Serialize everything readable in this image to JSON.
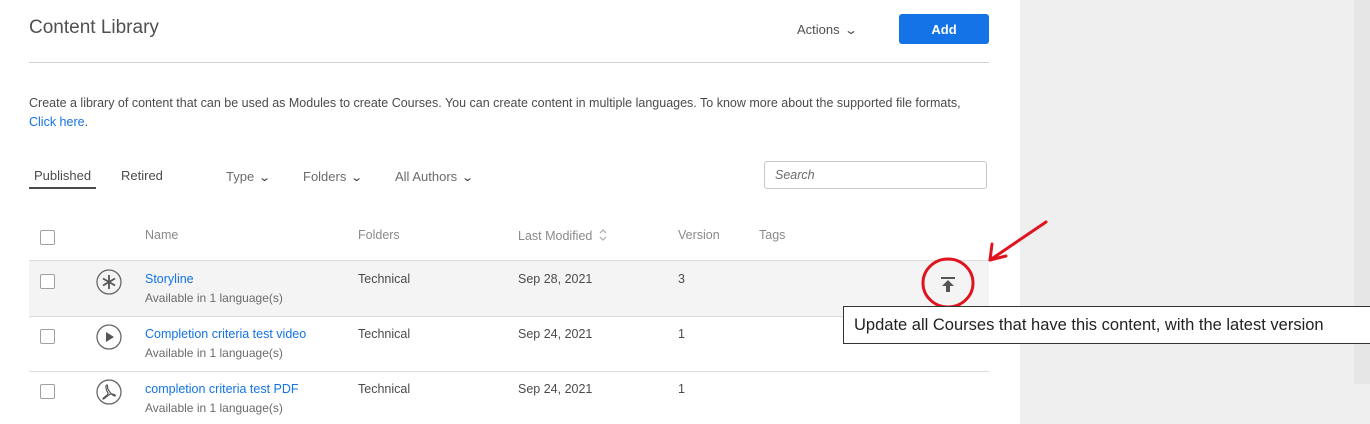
{
  "header": {
    "title": "Content Library",
    "actions_label": "Actions",
    "add_label": "Add"
  },
  "description": {
    "text": "Create a library of content that can be used as Modules to create Courses. You can create content in multiple languages. To know more about the supported file formats, ",
    "link": "Click here",
    "tail": "."
  },
  "tabs": {
    "published": "Published",
    "retired": "Retired"
  },
  "filters": {
    "type": "Type",
    "folders": "Folders",
    "authors": "All Authors"
  },
  "search": {
    "placeholder": "Search"
  },
  "columns": {
    "name": "Name",
    "folders": "Folders",
    "last_modified": "Last Modified",
    "version": "Version",
    "tags": "Tags"
  },
  "rows": [
    {
      "name": "Storyline",
      "sub": "Available in 1 language(s)",
      "folder": "Technical",
      "date": "Sep 28, 2021",
      "version": "3",
      "icon": "asterisk-icon"
    },
    {
      "name": "Completion criteria test video",
      "sub": "Available in 1 language(s)",
      "folder": "Technical",
      "date": "Sep 24, 2021",
      "version": "1",
      "icon": "play-icon"
    },
    {
      "name": "completion criteria test PDF",
      "sub": "Available in 1 language(s)",
      "folder": "Technical",
      "date": "Sep 24, 2021",
      "version": "1",
      "icon": "pdf-icon"
    }
  ],
  "tooltip": "Update all Courses that have this content, with the latest version",
  "colors": {
    "accent": "#1473e6",
    "annotation": "#e0141e"
  }
}
